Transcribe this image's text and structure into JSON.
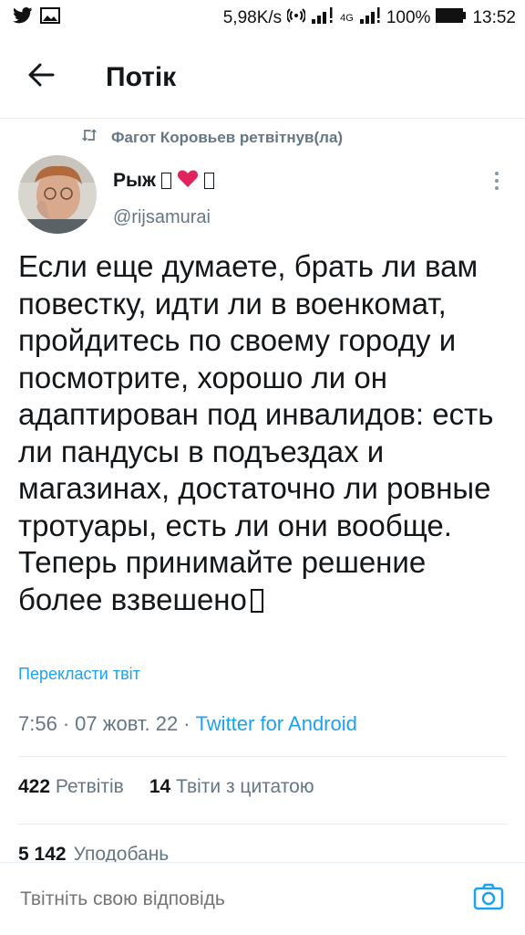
{
  "status_bar": {
    "speed": "5,98K/s",
    "network": "4G",
    "battery": "100%",
    "time": "13:52",
    "icons": [
      "twitter-icon",
      "image-icon",
      "hotspot-icon",
      "signal-icon",
      "battery-icon"
    ]
  },
  "header": {
    "title": "Потік",
    "back_icon": "arrow-left-icon"
  },
  "retweet_context": {
    "icon": "retweet-icon",
    "text": "Фагот Коровьев ретвітнув(ла)"
  },
  "tweet": {
    "author_name": "Рыж",
    "handle": "@rijsamurai",
    "text": "Если еще думаете, брать ли вам повестку, идти ли в военкомат, пройдитесь по своему городу и посмотрите, хорошо ли он адаптирован под инвалидов: есть ли пандусы в подъездах и магазинах, достаточно ли ровные тротуары, есть ли они вообще. Теперь принимайте решение более взвешено",
    "translate_label": "Перекласти твіт",
    "time": "7:56",
    "date": "07 жовт. 22",
    "separator": "·",
    "source": "Twitter for Android",
    "retweets_count": "422",
    "retweets_label": "Ретвітів",
    "quotes_count": "14",
    "quotes_label": "Твіти з цитатою",
    "likes_count": "5 142",
    "likes_label": "Уподобань"
  },
  "reply": {
    "placeholder": "Твітніть свою відповідь",
    "camera_icon": "camera-icon"
  },
  "colors": {
    "accent": "#1da1f2",
    "secondary_text": "#657786",
    "heart": "#e0245e"
  }
}
